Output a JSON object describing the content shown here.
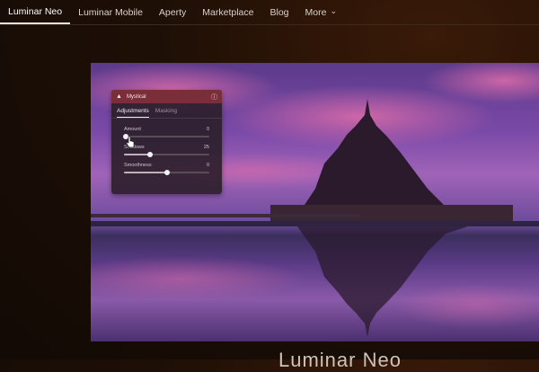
{
  "nav": {
    "items": [
      {
        "label": "Luminar Neo",
        "active": true
      },
      {
        "label": "Luminar Mobile",
        "active": false
      },
      {
        "label": "Aperty",
        "active": false
      },
      {
        "label": "Marketplace",
        "active": false
      },
      {
        "label": "Blog",
        "active": false
      },
      {
        "label": "More",
        "active": false
      }
    ],
    "more_icon": "chevron-down-icon"
  },
  "panel": {
    "title": "Mystical",
    "title_icon": "drop-icon",
    "info_icon": "info-icon",
    "tabs": [
      {
        "label": "Adjustments",
        "active": true
      },
      {
        "label": "Masking",
        "active": false
      }
    ],
    "sliders": [
      {
        "label": "Amount",
        "value": "0",
        "fraction": 0.02
      },
      {
        "label": "Shadows",
        "value": "25",
        "fraction": 0.3
      },
      {
        "label": "Smoothness",
        "value": "0",
        "fraction": 0.5
      }
    ]
  },
  "colors": {
    "accent": "#7a2e3a",
    "background": "#1e0f06"
  },
  "bottom_text": "Luminar Neo"
}
